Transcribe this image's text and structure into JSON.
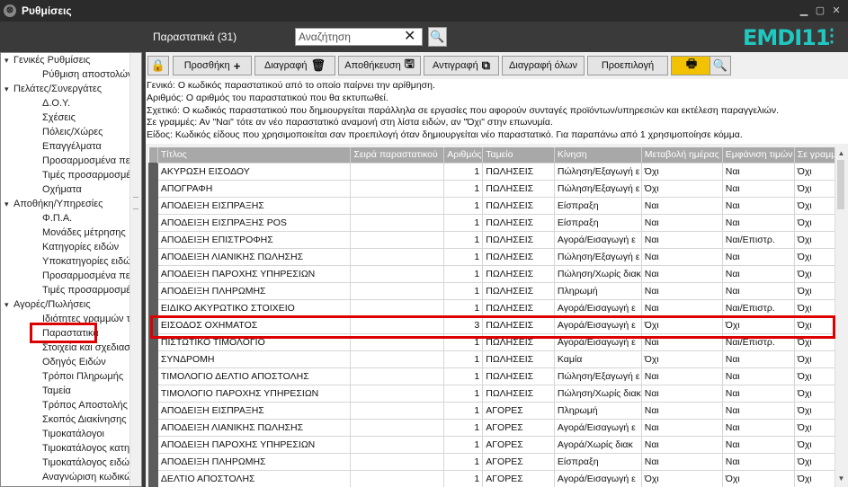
{
  "window": {
    "title": "Ρυθμίσεις"
  },
  "header": {
    "section_title": "Παραστατικά (31)",
    "search_placeholder": "Αναζήτηση",
    "logo": "EMDI11"
  },
  "sidebar": {
    "items": [
      {
        "label": "Γενικές Ρυθμίσεις",
        "level": 0
      },
      {
        "label": "Ρύθμιση αποστολών",
        "level": 1
      },
      {
        "label": "Πελάτες/Συνεργάτες",
        "level": 0
      },
      {
        "label": "Δ.Ο.Υ.",
        "level": 1
      },
      {
        "label": "Σχέσεις",
        "level": 1
      },
      {
        "label": "Πόλεις/Χώρες",
        "level": 1
      },
      {
        "label": "Επαγγέλματα",
        "level": 1
      },
      {
        "label": "Προσαρμοσμένα πε",
        "level": 1
      },
      {
        "label": "Τιμές προσαρμοσμέ",
        "level": 1
      },
      {
        "label": "Οχήματα",
        "level": 1
      },
      {
        "label": "Αποθήκη/Υπηρεσίες",
        "level": 0
      },
      {
        "label": "Φ.Π.Α.",
        "level": 1
      },
      {
        "label": "Μονάδες μέτρησης",
        "level": 1
      },
      {
        "label": "Κατηγορίες ειδών",
        "level": 1
      },
      {
        "label": "Υποκατηγορίες ειδώ",
        "level": 1
      },
      {
        "label": "Προσαρμοσμένα πε",
        "level": 1
      },
      {
        "label": "Τιμές προσαρμοσμέ",
        "level": 1
      },
      {
        "label": "Αγορές/Πωλήσεις",
        "level": 0
      },
      {
        "label": "Ιδιότητες γραμμών τ",
        "level": 1
      },
      {
        "label": "Παραστατικά",
        "level": 1
      },
      {
        "label": "Στοιχεία και σχεδιασ",
        "level": 1
      },
      {
        "label": "Οδηγός Ειδών",
        "level": 1
      },
      {
        "label": "Τρόποι Πληρωμής",
        "level": 1
      },
      {
        "label": "Ταμεία",
        "level": 1
      },
      {
        "label": "Τρόπος Αποστολής",
        "level": 1
      },
      {
        "label": "Σκοπός Διακίνησης",
        "level": 1
      },
      {
        "label": "Τιμοκατάλογοι",
        "level": 1
      },
      {
        "label": "Τιμοκατάλογος κατη",
        "level": 1
      },
      {
        "label": "Τιμοκατάλογος ειδώ",
        "level": 1
      },
      {
        "label": "Αναγνώριση κωδικώ",
        "level": 1
      }
    ]
  },
  "toolbar": {
    "add": "Προσθήκη",
    "delete": "Διαγραφή",
    "save": "Αποθήκευση",
    "copy": "Αντιγραφή",
    "delete_all": "Διαγραφή όλων",
    "default": "Προεπιλογή"
  },
  "info_lines": [
    "Γενικό: Ο κωδικός παραστατικού από το οποίο παίρνει την αρίθμηση.",
    "Αριθμός: Ο αριθμός του παραστατικού που θα εκτυπωθεί.",
    "Σχετικό: Ο κωδικός παραστατικού που δημιουργείται παράλληλα σε εργασίες που αφορούν συνταγές προϊόντων/υπηρεσιών και εκτέλεση παραγγελιών.",
    "Σε γραμμές: Αν \"Ναι\" τότε αν νέο παραστατικό αναμονή στη λίστα ειδών, αν \"Όχι\" στην επωνυμία.",
    "Είδος: Κωδικός είδους που χρησιμοποιείται σαν προεπιλογή όταν δημιουργείται νέο παραστατικό. Για παραπάνω από 1 χρησιμοποίησε κόμμα."
  ],
  "table": {
    "columns": [
      "Τίτλος",
      "Σειρά παραστατικού",
      "Αριθμός",
      "Ταμείο",
      "Κίνηση",
      "Μεταβολή ημέρας",
      "Εμφάνιση τιμών",
      "Σε γραμμές"
    ],
    "rows": [
      [
        "ΑΚΥΡΩΣΗ ΕΙΣΟΔΟΥ",
        "",
        "1",
        "ΠΩΛΗΣΕΙΣ",
        "Πώληση/Εξαγωγή ε",
        "Όχι",
        "Ναι",
        "Όχι"
      ],
      [
        "ΑΠΟΓΡΑΦΗ",
        "",
        "1",
        "ΠΩΛΗΣΕΙΣ",
        "Πώληση/Εξαγωγή ε",
        "Όχι",
        "Ναι",
        "Όχι"
      ],
      [
        "ΑΠΟΔΕΙΞΗ ΕΙΣΠΡΑΞΗΣ",
        "",
        "1",
        "ΠΩΛΗΣΕΙΣ",
        "Είσπραξη",
        "Ναι",
        "Ναι",
        "Όχι"
      ],
      [
        "ΑΠΟΔΕΙΞΗ ΕΙΣΠΡΑΞΗΣ POS",
        "",
        "1",
        "ΠΩΛΗΣΕΙΣ",
        "Είσπραξη",
        "Ναι",
        "Ναι",
        "Όχι"
      ],
      [
        "ΑΠΟΔΕΙΞΗ ΕΠΙΣΤΡΟΦΗΣ",
        "",
        "1",
        "ΠΩΛΗΣΕΙΣ",
        "Αγορά/Εισαγωγή ε",
        "Ναι",
        "Ναι/Επιστρ.",
        "Όχι"
      ],
      [
        "ΑΠΟΔΕΙΞΗ ΛΙΑΝΙΚΗΣ ΠΩΛΗΣΗΣ",
        "",
        "1",
        "ΠΩΛΗΣΕΙΣ",
        "Πώληση/Εξαγωγή ε",
        "Ναι",
        "Ναι",
        "Όχι"
      ],
      [
        "ΑΠΟΔΕΙΞΗ ΠΑΡΟΧΗΣ ΥΠΗΡΕΣΙΩΝ",
        "",
        "1",
        "ΠΩΛΗΣΕΙΣ",
        "Πώληση/Χωρίς διακ",
        "Ναι",
        "Ναι",
        "Όχι"
      ],
      [
        "ΑΠΟΔΕΙΞΗ ΠΛΗΡΩΜΗΣ",
        "",
        "1",
        "ΠΩΛΗΣΕΙΣ",
        "Πληρωμή",
        "Ναι",
        "Ναι",
        "Όχι"
      ],
      [
        "ΕΙΔΙΚΟ ΑΚΥΡΩΤΙΚΟ ΣΤΟΙΧΕΙΟ",
        "",
        "1",
        "ΠΩΛΗΣΕΙΣ",
        "Αγορά/Εισαγωγή ε",
        "Ναι",
        "Ναι/Επιστρ.",
        "Όχι"
      ],
      [
        "ΕΙΣΟΔΟΣ ΟΧΗΜΑΤΟΣ",
        "",
        "3",
        "ΠΩΛΗΣΕΙΣ",
        "Αγορά/Εισαγωγή ε",
        "Όχι",
        "Όχι",
        "Όχι"
      ],
      [
        "ΠΙΣΤΩΤΙΚΟ ΤΙΜΟΛΟΓΙΟ",
        "",
        "1",
        "ΠΩΛΗΣΕΙΣ",
        "Αγορά/Εισαγωγή ε",
        "Ναι",
        "Ναι/Επιστρ.",
        "Όχι"
      ],
      [
        "ΣΥΝΔΡΟΜΗ",
        "",
        "1",
        "ΠΩΛΗΣΕΙΣ",
        "Καμία",
        "Όχι",
        "Ναι",
        "Όχι"
      ],
      [
        "ΤΙΜΟΛΟΓΙΟ ΔΕΛΤΙΟ ΑΠΟΣΤΟΛΗΣ",
        "",
        "1",
        "ΠΩΛΗΣΕΙΣ",
        "Πώληση/Εξαγωγή ε",
        "Ναι",
        "Ναι",
        "Όχι"
      ],
      [
        "ΤΙΜΟΛΟΓΙΟ ΠΑΡΟΧΗΣ ΥΠΗΡΕΣΙΩΝ",
        "",
        "1",
        "ΠΩΛΗΣΕΙΣ",
        "Πώληση/Χωρίς διακ",
        "Ναι",
        "Ναι",
        "Όχι"
      ],
      [
        "ΑΠΟΔΕΙΞΗ ΕΙΣΠΡΑΞΗΣ",
        "",
        "1",
        "ΑΓΟΡΕΣ",
        "Πληρωμή",
        "Ναι",
        "Ναι",
        "Όχι"
      ],
      [
        "ΑΠΟΔΕΙΞΗ ΛΙΑΝΙΚΗΣ ΠΩΛΗΣΗΣ",
        "",
        "1",
        "ΑΓΟΡΕΣ",
        "Αγορά/Εισαγωγή ε",
        "Ναι",
        "Ναι",
        "Όχι"
      ],
      [
        "ΑΠΟΔΕΙΞΗ ΠΑΡΟΧΗΣ ΥΠΗΡΕΣΙΩΝ",
        "",
        "1",
        "ΑΓΟΡΕΣ",
        "Αγορά/Χωρίς διακ",
        "Ναι",
        "Ναι",
        "Όχι"
      ],
      [
        "ΑΠΟΔΕΙΞΗ ΠΛΗΡΩΜΗΣ",
        "",
        "1",
        "ΑΓΟΡΕΣ",
        "Είσπραξη",
        "Ναι",
        "Ναι",
        "Όχι"
      ],
      [
        "ΔΕΛΤΙΟ ΑΠΟΣΤΟΛΗΣ",
        "",
        "1",
        "ΑΓΟΡΕΣ",
        "Αγορά/Εισαγωγή ε",
        "Όχι",
        "Όχι",
        "Όχι"
      ]
    ],
    "highlighted_row": 9
  },
  "colors": {
    "highlight_box": "#dd0000",
    "header_bg": "#a8a8a8",
    "logo": "#1fc8c0"
  }
}
